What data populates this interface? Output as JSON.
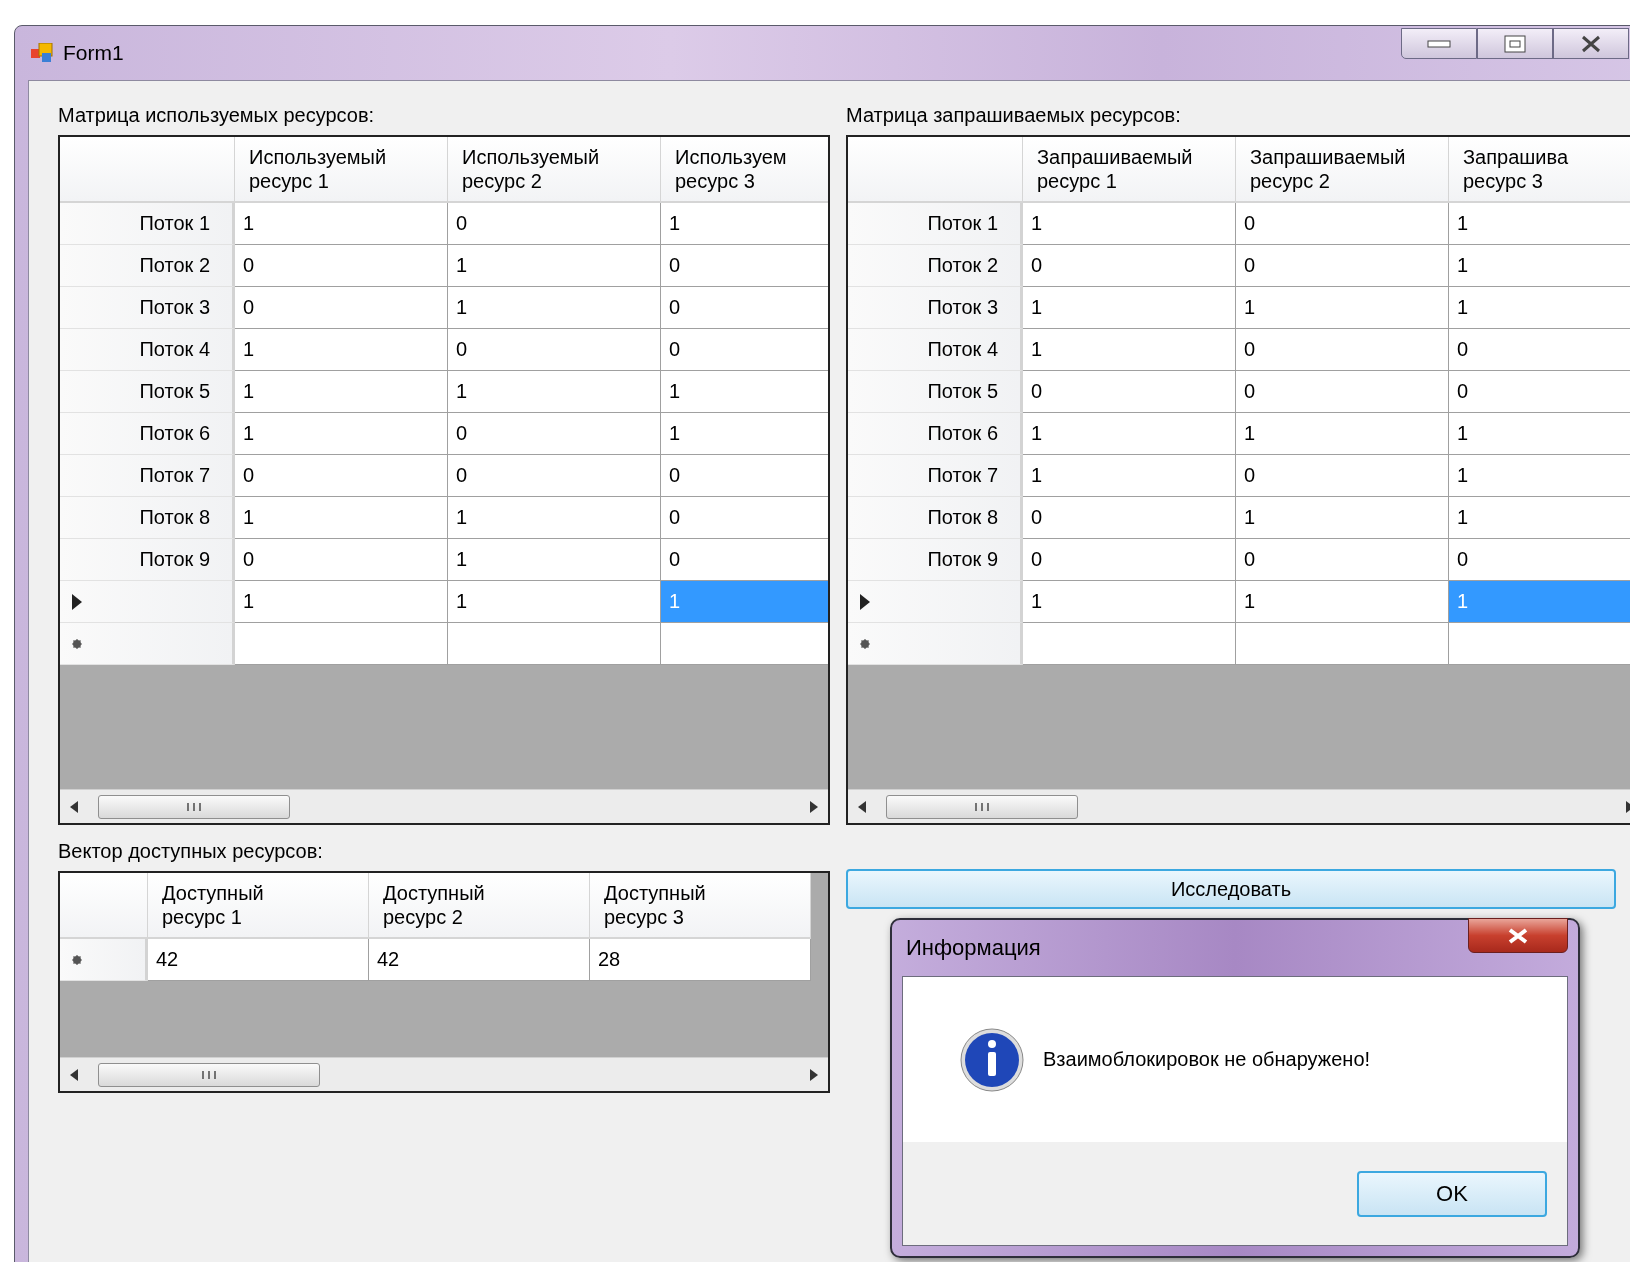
{
  "window": {
    "title": "Form1"
  },
  "used_matrix": {
    "label": "Матрица используемых ресурсов:",
    "columns": [
      "Используемый\nресурс 1",
      "Используемый\nресурс 2",
      "Используем\nресурс 3"
    ],
    "rows": [
      {
        "header": "Поток 1",
        "cells": [
          {
            "text": "1",
            "selected": false
          },
          {
            "text": "0",
            "selected": false
          },
          {
            "text": "1",
            "selected": false
          }
        ]
      },
      {
        "header": "Поток 2",
        "cells": [
          {
            "text": "0",
            "selected": false
          },
          {
            "text": "1",
            "selected": false
          },
          {
            "text": "0",
            "selected": false
          }
        ]
      },
      {
        "header": "Поток 3",
        "cells": [
          {
            "text": "0",
            "selected": false
          },
          {
            "text": "1",
            "selected": false
          },
          {
            "text": "0",
            "selected": false
          }
        ]
      },
      {
        "header": "Поток 4",
        "cells": [
          {
            "text": "1",
            "selected": false
          },
          {
            "text": "0",
            "selected": false
          },
          {
            "text": "0",
            "selected": false
          }
        ]
      },
      {
        "header": "Поток 5",
        "cells": [
          {
            "text": "1",
            "selected": false
          },
          {
            "text": "1",
            "selected": false
          },
          {
            "text": "1",
            "selected": false
          }
        ]
      },
      {
        "header": "Поток 6",
        "cells": [
          {
            "text": "1",
            "selected": false
          },
          {
            "text": "0",
            "selected": false
          },
          {
            "text": "1",
            "selected": false
          }
        ]
      },
      {
        "header": "Поток 7",
        "cells": [
          {
            "text": "0",
            "selected": false
          },
          {
            "text": "0",
            "selected": false
          },
          {
            "text": "0",
            "selected": false
          }
        ]
      },
      {
        "header": "Поток 8",
        "cells": [
          {
            "text": "1",
            "selected": false
          },
          {
            "text": "1",
            "selected": false
          },
          {
            "text": "0",
            "selected": false
          }
        ]
      },
      {
        "header": "Поток 9",
        "cells": [
          {
            "text": "0",
            "selected": false
          },
          {
            "text": "1",
            "selected": false
          },
          {
            "text": "0",
            "selected": false
          }
        ]
      },
      {
        "kind": "current",
        "cells": [
          {
            "text": "1",
            "selected": false
          },
          {
            "text": "1",
            "selected": false
          },
          {
            "text": "1",
            "selected": true
          }
        ]
      },
      {
        "kind": "new"
      }
    ]
  },
  "requested_matrix": {
    "label": "Матрица запрашиваемых ресурсов:",
    "columns": [
      "Запрашиваемый\nресурс 1",
      "Запрашиваемый\nресурс 2",
      "Запрашива\nресурс 3"
    ],
    "rows": [
      {
        "header": "Поток 1",
        "cells": [
          {
            "text": "1",
            "selected": false
          },
          {
            "text": "0",
            "selected": false
          },
          {
            "text": "1",
            "selected": false
          }
        ]
      },
      {
        "header": "Поток 2",
        "cells": [
          {
            "text": "0",
            "selected": false
          },
          {
            "text": "0",
            "selected": false
          },
          {
            "text": "1",
            "selected": false
          }
        ]
      },
      {
        "header": "Поток 3",
        "cells": [
          {
            "text": "1",
            "selected": false
          },
          {
            "text": "1",
            "selected": false
          },
          {
            "text": "1",
            "selected": false
          }
        ]
      },
      {
        "header": "Поток 4",
        "cells": [
          {
            "text": "1",
            "selected": false
          },
          {
            "text": "0",
            "selected": false
          },
          {
            "text": "0",
            "selected": false
          }
        ]
      },
      {
        "header": "Поток 5",
        "cells": [
          {
            "text": "0",
            "selected": false
          },
          {
            "text": "0",
            "selected": false
          },
          {
            "text": "0",
            "selected": false
          }
        ]
      },
      {
        "header": "Поток 6",
        "cells": [
          {
            "text": "1",
            "selected": false
          },
          {
            "text": "1",
            "selected": false
          },
          {
            "text": "1",
            "selected": false
          }
        ]
      },
      {
        "header": "Поток 7",
        "cells": [
          {
            "text": "1",
            "selected": false
          },
          {
            "text": "0",
            "selected": false
          },
          {
            "text": "1",
            "selected": false
          }
        ]
      },
      {
        "header": "Поток 8",
        "cells": [
          {
            "text": "0",
            "selected": false
          },
          {
            "text": "1",
            "selected": false
          },
          {
            "text": "1",
            "selected": false
          }
        ]
      },
      {
        "header": "Поток 9",
        "cells": [
          {
            "text": "0",
            "selected": false
          },
          {
            "text": "0",
            "selected": false
          },
          {
            "text": "0",
            "selected": false
          }
        ]
      },
      {
        "kind": "current",
        "cells": [
          {
            "text": "1",
            "selected": false
          },
          {
            "text": "1",
            "selected": false
          },
          {
            "text": "1",
            "selected": true
          }
        ]
      },
      {
        "kind": "new"
      }
    ]
  },
  "available_vector": {
    "label": "Вектор доступных ресурсов:",
    "columns": [
      "Доступный\nресурс 1",
      "Доступный\nресурс 2",
      "Доступный\nресурс 3"
    ],
    "rows": [
      {
        "kind": "new",
        "cells": [
          {
            "text": "42",
            "selected": false
          },
          {
            "text": "42",
            "selected": false
          },
          {
            "text": "28",
            "selected": false
          }
        ]
      }
    ]
  },
  "analyze_button": "Исследовать",
  "dialog": {
    "title": "Информация",
    "message": "Взаимоблокировок не обнаружено!",
    "button": "OK"
  }
}
